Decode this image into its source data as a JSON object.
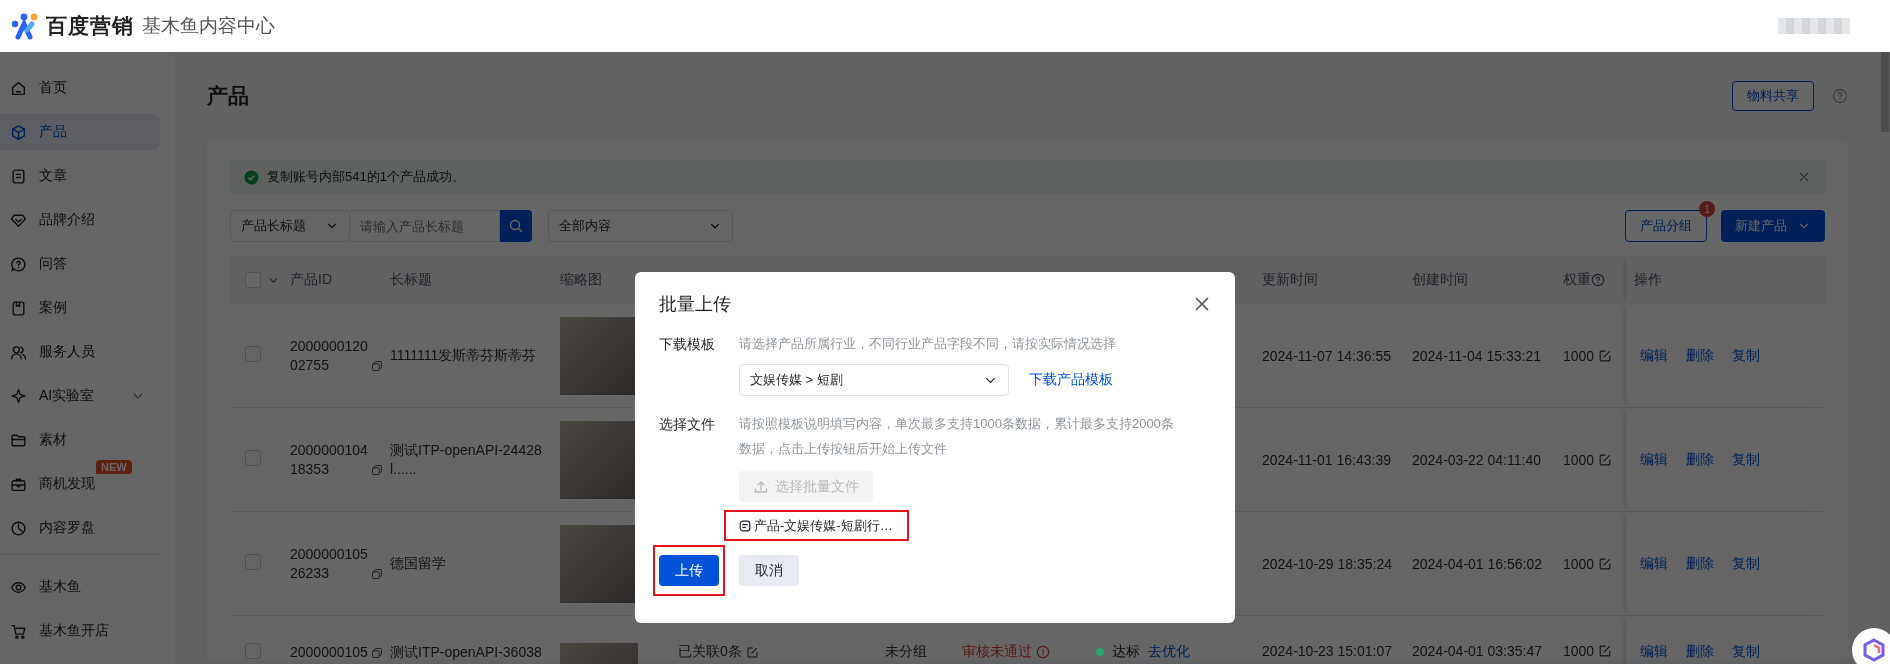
{
  "header": {
    "brand": "百度营销",
    "product": "基木鱼内容中心"
  },
  "sidebar": {
    "items": [
      {
        "label": "首页",
        "selected": false
      },
      {
        "label": "产品",
        "selected": true
      },
      {
        "label": "文章",
        "selected": false
      },
      {
        "label": "品牌介绍",
        "selected": false
      },
      {
        "label": "问答",
        "selected": false
      },
      {
        "label": "案例",
        "selected": false
      },
      {
        "label": "服务人员",
        "selected": false
      },
      {
        "label": "AI实验室",
        "selected": false,
        "expanded": false
      },
      {
        "label": "素材",
        "selected": false
      },
      {
        "label": "商机发现",
        "selected": false,
        "badge": "NEW"
      },
      {
        "label": "内容罗盘",
        "selected": false
      }
    ],
    "bottom_items": [
      {
        "label": "基木鱼",
        "selected": false
      },
      {
        "label": "基木鱼开店",
        "selected": false
      }
    ]
  },
  "page": {
    "title": "产品",
    "share_button": "物料共享"
  },
  "alert": {
    "message": "复制账号内部541的1个产品成功。"
  },
  "filters": {
    "field_select": "产品长标题",
    "search": {
      "placeholder": "请输入产品长标题"
    },
    "content_select": "全部内容",
    "group_button": "产品分组",
    "group_badge": "1",
    "new_button": "新建产品"
  },
  "table": {
    "select_all": false,
    "columns": [
      "产品ID",
      "长标题",
      "缩略图",
      "更新时间",
      "创建时间",
      "权重",
      "操作"
    ],
    "rows": [
      {
        "checked": false,
        "id": "200000012002755",
        "title": "1111111发斯蒂芬斯蒂芬",
        "updated": "2024-11-07 14:36:55",
        "created": "2024-11-04 15:33:21",
        "weight": "1000",
        "actions": [
          "编辑",
          "删除",
          "复制"
        ]
      },
      {
        "checked": false,
        "id": "200000010418353",
        "title": "测试ITP-openAPI-24428l......",
        "updated": "2024-11-01 16:43:39",
        "created": "2024-03-22 04:11:40",
        "weight": "1000",
        "actions": [
          "编辑",
          "删除",
          "复制"
        ]
      },
      {
        "checked": false,
        "id": "200000010526233",
        "title": "德国留学",
        "updated": "2024-10-29 18:35:24",
        "created": "2024-04-01 16:56:02",
        "weight": "1000",
        "actions": [
          "编辑",
          "删除",
          "复制"
        ]
      },
      {
        "checked": false,
        "id": "2000000105",
        "title": "测试ITP-openAPI-36038",
        "column_4": "已关联0条",
        "column_5": "未分组",
        "column_6": "审核未通过",
        "status": {
          "label": "达标",
          "color": "#2ba471"
        },
        "status_link": "去优化",
        "updated": "2024-10-23 15:01:07",
        "created": "2024-04-01 03:35:47",
        "weight": "1000",
        "actions": [
          "编辑",
          "删除",
          "复制"
        ]
      }
    ]
  },
  "modal": {
    "title": "批量上传",
    "template": {
      "label": "下载模板",
      "hint": "请选择产品所属行业，不同行业产品字段不同，请按实际情况选择",
      "select_value": "文娱传媒 > 短剧",
      "link": "下载产品模板"
    },
    "file": {
      "label": "选择文件",
      "hint": "请按照模板说明填写内容，单次最多支持1000条数据，累计最多支持2000条数据，点击上传按钮后开始上传文件",
      "button": "选择批量文件",
      "button_disabled": true,
      "file_name": "产品-文娱传媒-短剧行…",
      "highlighted": true
    },
    "buttons": [
      {
        "label": "上传",
        "kind": "primary",
        "highlighted": true
      },
      {
        "label": "取消",
        "kind": "secondary",
        "highlighted": false
      }
    ]
  }
}
